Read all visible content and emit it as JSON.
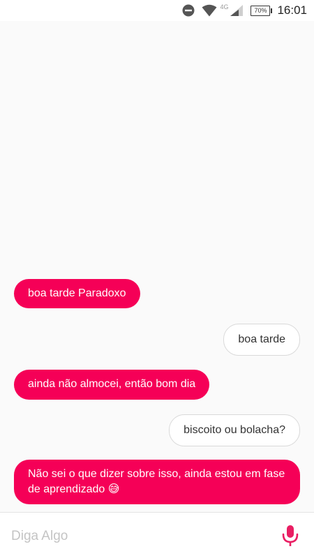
{
  "status_bar": {
    "network_type": "4G",
    "battery": "70%",
    "battery_level": 0.7,
    "time": "16:01",
    "icons": [
      "do-not-disturb-icon",
      "wifi-icon",
      "signal-icon",
      "battery-icon"
    ]
  },
  "messages": [
    {
      "from": "bot",
      "text": "boa tarde Paradoxo"
    },
    {
      "from": "user",
      "text": "boa tarde"
    },
    {
      "from": "bot",
      "text": "ainda não almocei, então bom dia"
    },
    {
      "from": "user",
      "text": "biscoito ou bolacha?"
    },
    {
      "from": "bot",
      "text": "Não sei o que dizer sobre isso, ainda estou em fase de aprendizado 😅"
    }
  ],
  "input": {
    "placeholder": "Diga Algo",
    "value": ""
  },
  "colors": {
    "bot_bubble": "#f50057",
    "accent": "#e91e63",
    "user_bubble_border": "#d9d9d9"
  }
}
